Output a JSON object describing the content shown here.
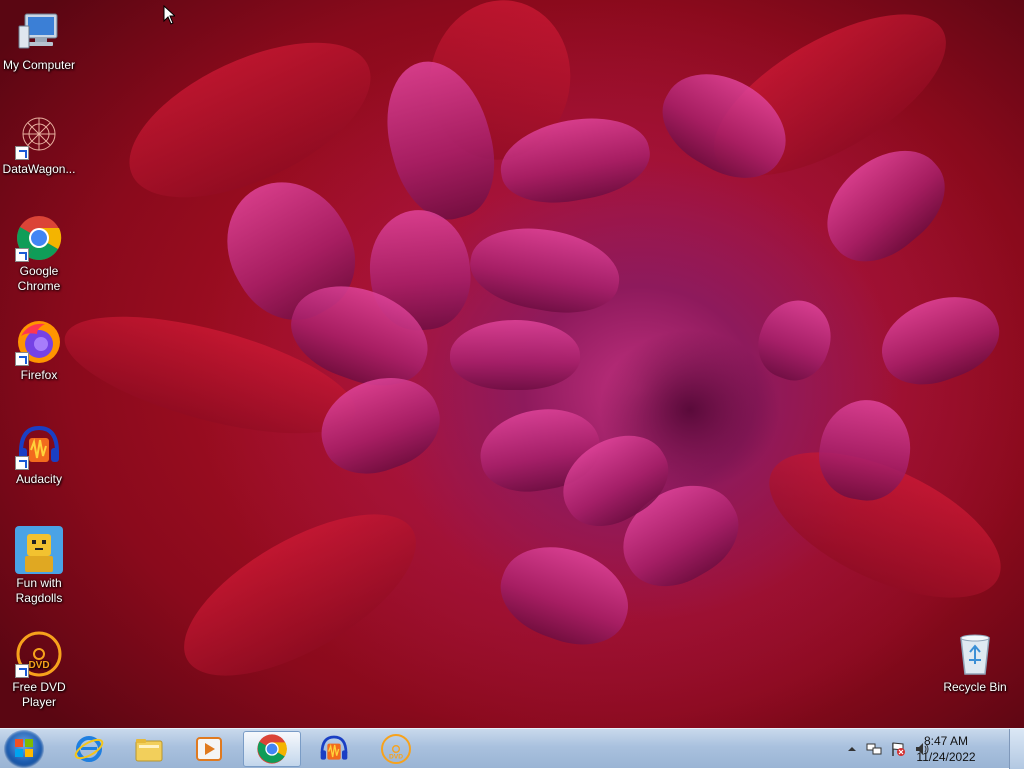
{
  "desktop": {
    "icons": [
      {
        "label": "My Computer",
        "icon": "computer-icon"
      },
      {
        "label": "DataWagon...",
        "icon": "datawagon-icon"
      },
      {
        "label": "Google Chrome",
        "icon": "chrome-icon"
      },
      {
        "label": "Firefox",
        "icon": "firefox-icon"
      },
      {
        "label": "Audacity",
        "icon": "audacity-icon"
      },
      {
        "label": "Fun with Ragdolls",
        "icon": "ragdolls-icon"
      },
      {
        "label": "Free DVD Player",
        "icon": "dvd-player-icon"
      },
      {
        "label": "Recycle Bin",
        "icon": "recycle-bin-icon"
      }
    ]
  },
  "taskbar": {
    "start": {
      "icon": "windows-start-icon"
    },
    "pinned": [
      {
        "icon": "internet-explorer-icon",
        "active": false
      },
      {
        "icon": "file-explorer-icon",
        "active": false
      },
      {
        "icon": "media-player-icon",
        "active": false
      },
      {
        "icon": "chrome-icon",
        "active": true
      },
      {
        "icon": "audacity-icon",
        "active": false
      },
      {
        "icon": "dvd-player-icon",
        "active": false
      }
    ],
    "tray": {
      "icons": [
        "show-hidden-icons-arrow",
        "network-icon",
        "action-center-flag-icon",
        "volume-icon"
      ],
      "time": "8:47 AM",
      "date": "11/24/2022"
    }
  },
  "colors": {
    "taskbar": "#a9c1de",
    "accent": "#1d5db0"
  }
}
